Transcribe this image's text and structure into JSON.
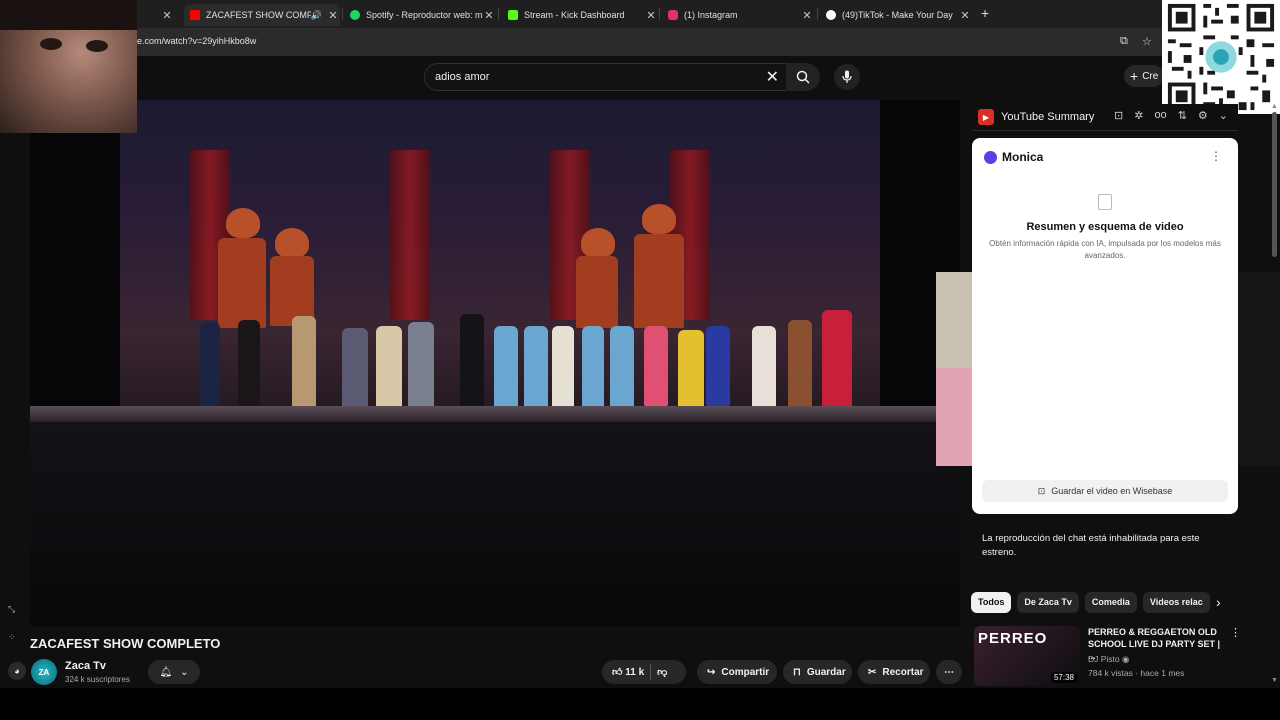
{
  "browser": {
    "tabs": [
      {
        "label": "",
        "icon_color": "#000000"
      },
      {
        "label": "ZACAFEST SHOW COMPLETO",
        "icon_color": "#ff0000",
        "active": true
      },
      {
        "label": "Spotify - Reproductor web: mú",
        "icon_color": "#1ed760"
      },
      {
        "label": "Stream - Kick Dashboard",
        "icon_color": "#53fc18"
      },
      {
        "label": "(1) Instagram",
        "icon_color": "#e1306c"
      },
      {
        "label": "(49)TikTok - Make Your Day",
        "icon_color": "#ffffff"
      }
    ],
    "url": "e.com/watch?v=29yihHkbo8w"
  },
  "youtube": {
    "search_value": "adios amor",
    "create_label": "Cre",
    "video_title": "ZACAFEST SHOW COMPLETO",
    "channel_name": "Zaca Tv",
    "channel_avatar_text": "ZA",
    "subscribers": "324 k suscriptores",
    "likes": "11 k",
    "share_label": "Compartir",
    "save_label": "Guardar",
    "clip_label": "Recortar"
  },
  "extension": {
    "title": "YouTube Summary",
    "monica_name": "Monica",
    "summary_title": "Resumen y esquema de video",
    "summary_sub": "Obtén información rápida con IA, impulsada por los modelos más avanzados.",
    "wisebase_label": "Guardar el video en Wisebase"
  },
  "chat": {
    "disabled_text": "La reproducción del chat está inhabilitada para este estreno."
  },
  "chips": [
    "Todos",
    "De Zaca Tv",
    "Comedia",
    "Videos relac"
  ],
  "recommendation": {
    "thumb_text": "PERREO",
    "duration": "57:38",
    "title": "PERREO & REGGAETON OLD SCHOOL LIVE DJ PARTY SET | ...",
    "channel": "DJ Pisto",
    "meta": "784 k vistas · hace 1 mes"
  },
  "colors": {
    "background": "#0f0f0f",
    "surface": "#272727",
    "accent": "#ff0000",
    "monica": "#5b3fe0"
  }
}
